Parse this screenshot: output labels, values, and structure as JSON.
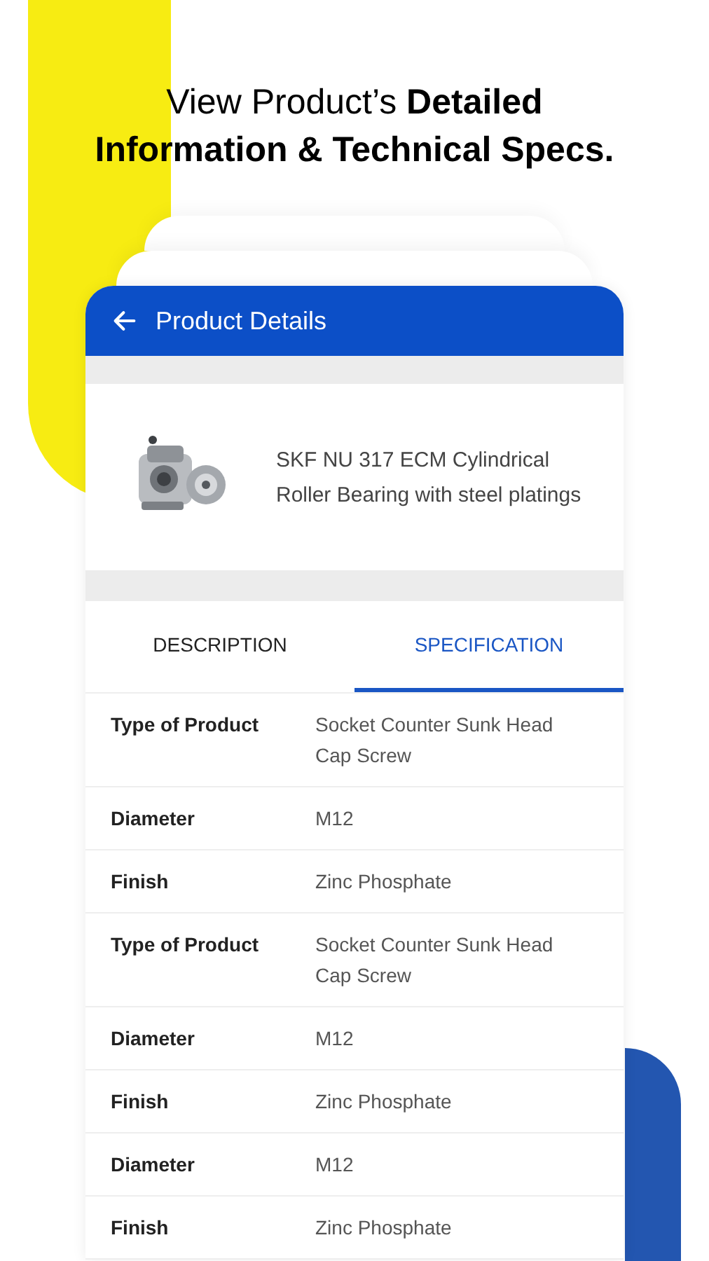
{
  "headline": [
    "View Product’s **Detailed**",
    "**Information & Technical Specs.**"
  ],
  "screen": {
    "title": "Product Details",
    "product": {
      "name": "SKF NU 317 ECM Cylindrical Roller Bearing with steel platings"
    },
    "tabs": [
      {
        "label": "DESCRIPTION",
        "selected": false
      },
      {
        "label": "SPECIFICATION",
        "selected": true
      }
    ],
    "specs": [
      {
        "label": "Type of Product",
        "value": "Socket Counter Sunk Head Cap Screw"
      },
      {
        "label": "Diameter",
        "value": "M12"
      },
      {
        "label": "Finish",
        "value": "Zinc Phosphate"
      },
      {
        "label": "Type of Product",
        "value": "Socket Counter Sunk Head Cap Screw"
      },
      {
        "label": "Diameter",
        "value": "M12"
      },
      {
        "label": "Finish",
        "value": "Zinc Phosphate"
      },
      {
        "label": "Diameter",
        "value": "M12"
      },
      {
        "label": "Finish",
        "value": "Zinc Phosphate"
      }
    ]
  }
}
